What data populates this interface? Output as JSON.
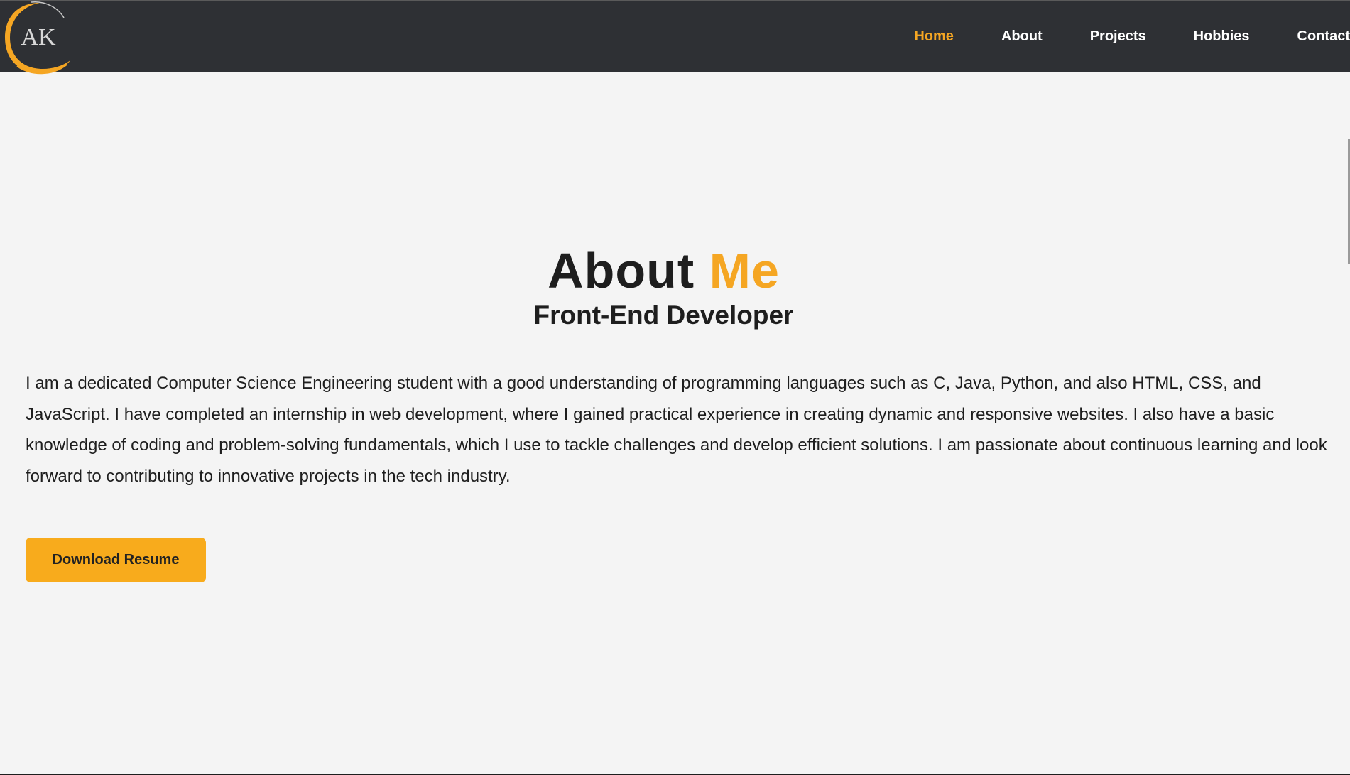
{
  "header": {
    "logo_text": "AK",
    "nav": [
      {
        "label": "Home",
        "active": true
      },
      {
        "label": "About",
        "active": false
      },
      {
        "label": "Projects",
        "active": false
      },
      {
        "label": "Hobbies",
        "active": false
      },
      {
        "label": "Contact",
        "active": false
      }
    ]
  },
  "main": {
    "title_part1": "About",
    "title_part2": "Me",
    "subtitle": "Front-End Developer",
    "bio": "I am a dedicated Computer Science Engineering student with a good understanding of programming languages such as C, Java, Python, and also HTML, CSS, and JavaScript. I have completed an internship in web development, where I gained practical experience in creating dynamic and responsive websites. I also have a basic knowledge of coding and problem-solving fundamentals, which I use to tackle challenges and develop efficient solutions. I am passionate about continuous learning and look forward to contributing to innovative projects in the tech industry.",
    "download_button": "Download Resume"
  },
  "colors": {
    "accent": "#f5a623",
    "header_bg": "#2e3034",
    "page_bg": "#f4f4f4",
    "button_bg": "#f8ab1c"
  }
}
